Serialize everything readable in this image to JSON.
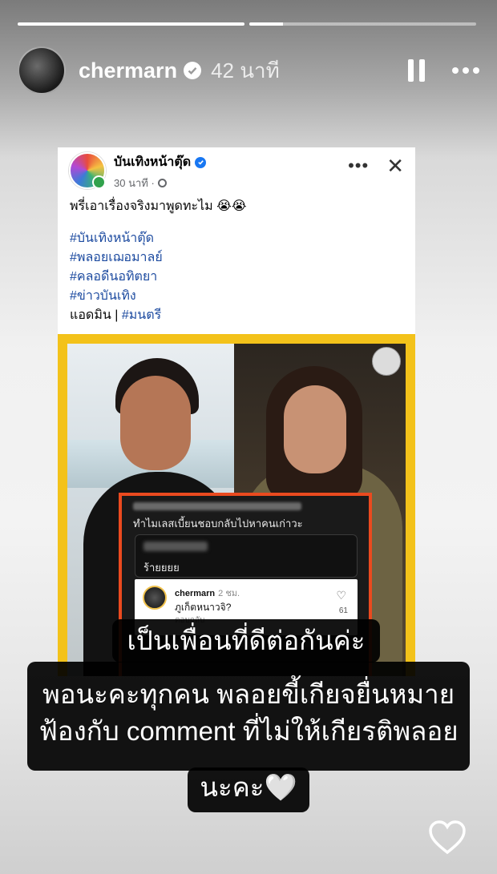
{
  "story": {
    "progress": [
      1.0,
      0.15
    ],
    "username": "chermarn",
    "time_ago": "42 นาที"
  },
  "post": {
    "page_name": "บันเทิงหน้าตุ๊ด",
    "time": "30 นาที ·",
    "lines": [
      "พรี่เอาเรื่องจริงมาพูดทะไม 😭😭"
    ],
    "hashtags": [
      "#บันเทิงหน้าตุ๊ด",
      "#พลอยเฌอมาลย์",
      "#คลอดีนอทิตยา",
      "#ข่าวบันเทิง"
    ],
    "admin_label": "แอดมิน | ",
    "admin_tag": "#มนตรี"
  },
  "comment_shot": {
    "question": "ทำไมเลสเบี้ยนชอบกลับไปหาคนเก่าวะ",
    "reply_text": "ร้ายยยย",
    "reply_name": "chermarn",
    "reply_time": "2 ชม.",
    "reply_body": "ภูเก็ตหนาวจิ?",
    "reply_action": "ตอบกลับ",
    "likes": "61"
  },
  "captions": {
    "line1": "เป็นเพื่อนที่ดีต่อกันค่ะ",
    "line2": "พอนะคะทุกคน พลอยขี้เกียจยื่นหมาย",
    "line3": "ฟ้องกับ comment ที่ไม่ให้เกียรติพลอย",
    "line4": "นะคะ🤍"
  }
}
